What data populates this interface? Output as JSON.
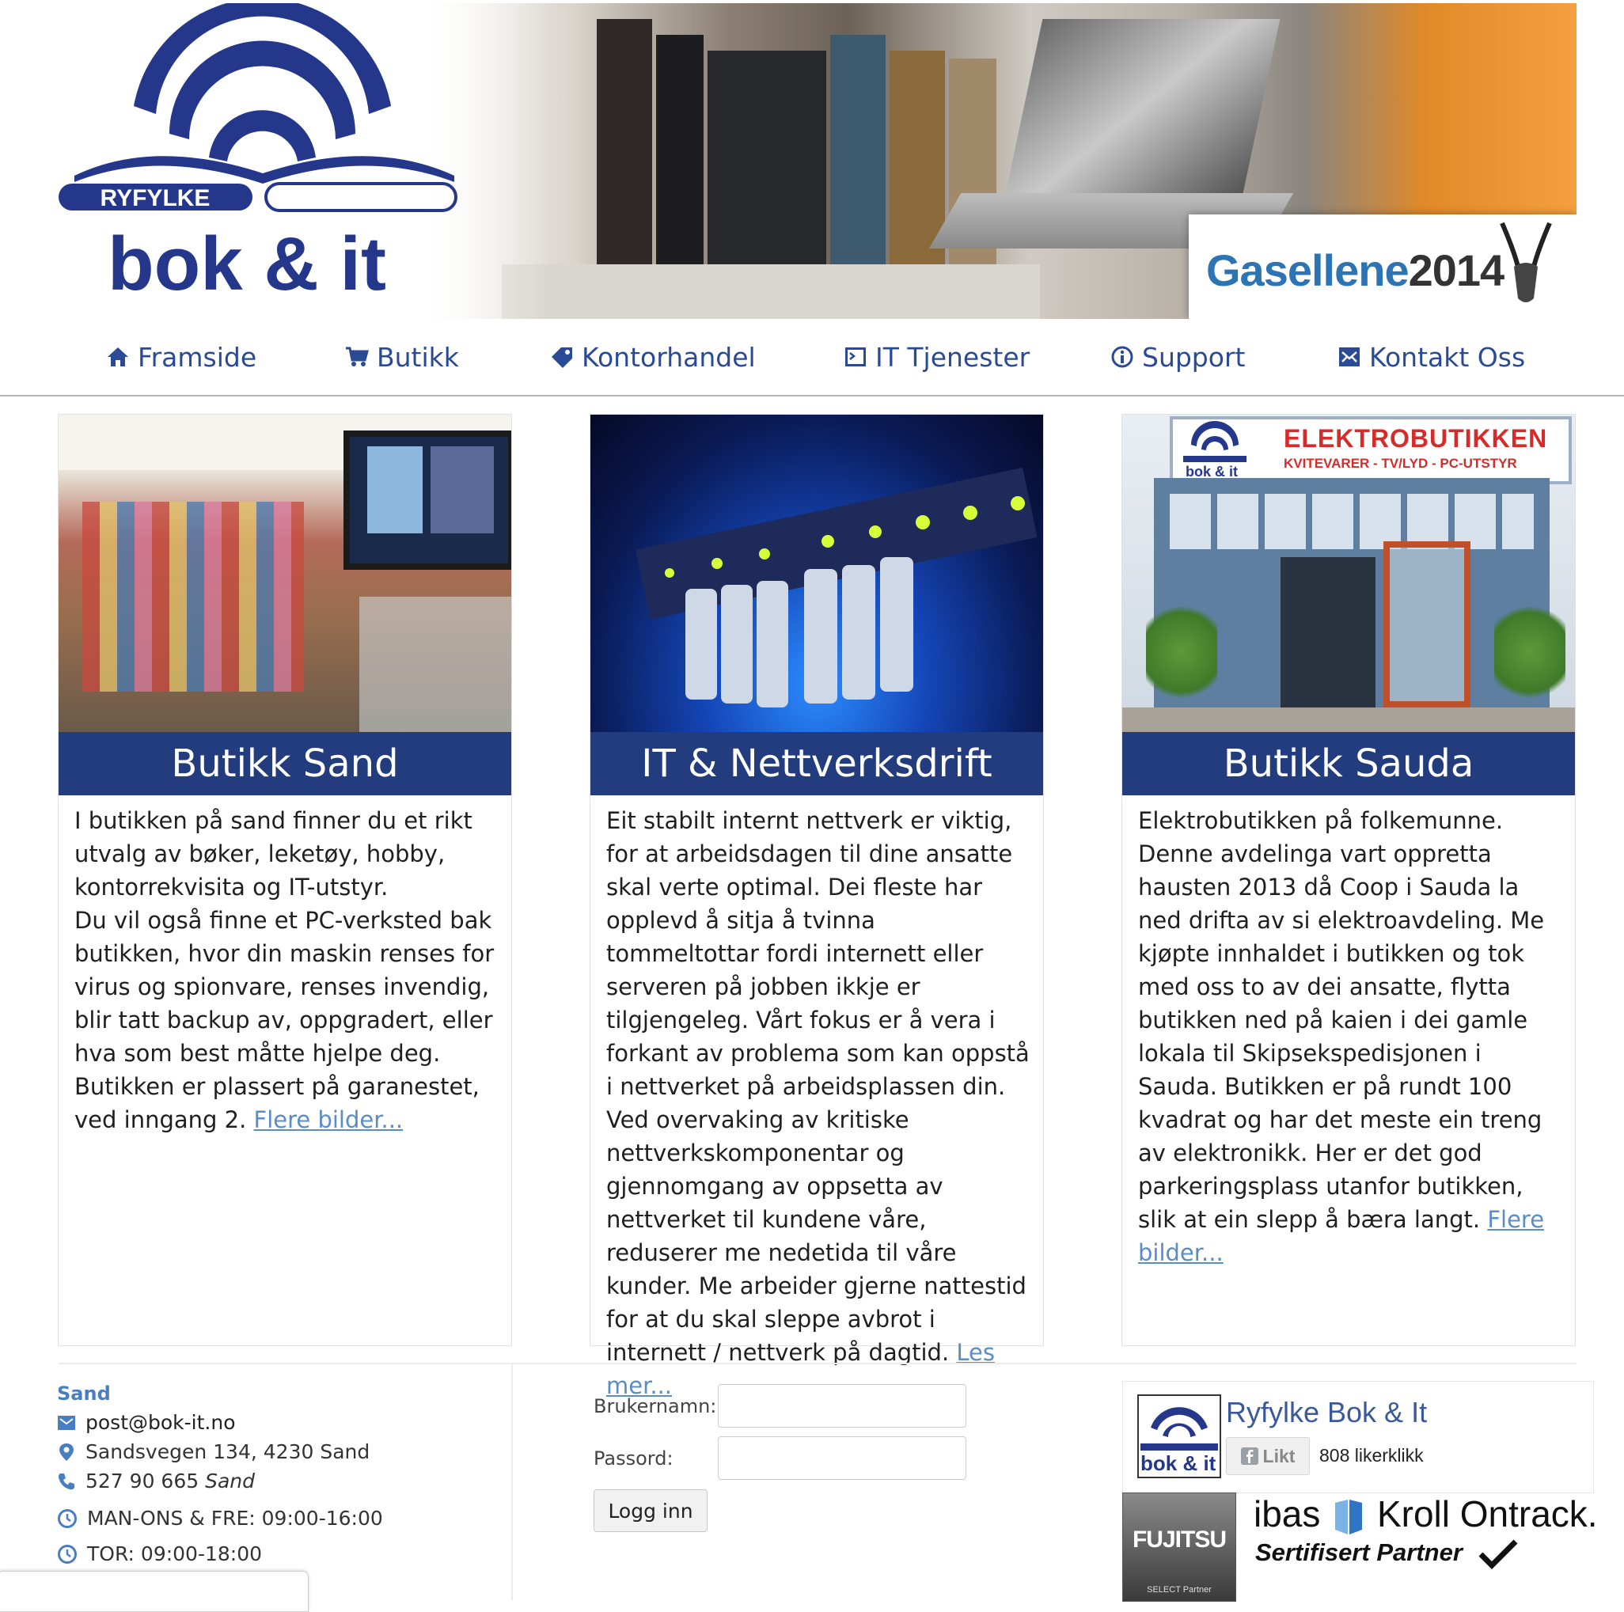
{
  "banner": {
    "logo_top_word": "RYFYLKE",
    "logo_main": "bok & it",
    "award_word": "Gasellene",
    "award_year": "2014"
  },
  "nav": {
    "items": [
      {
        "label": "Framside",
        "icon": "home-icon"
      },
      {
        "label": "Butikk",
        "icon": "cart-icon"
      },
      {
        "label": "Kontorhandel",
        "icon": "tag-icon"
      },
      {
        "label": "IT Tjenester",
        "icon": "terminal-icon"
      },
      {
        "label": "Support",
        "icon": "info-icon"
      },
      {
        "label": "Kontakt Oss",
        "icon": "envelope-icon"
      }
    ]
  },
  "cards": [
    {
      "title": "Butikk Sand",
      "text": "I butikken på sand finner du et rikt utvalg av bøker, leketøy, hobby, kontorrekvisita og IT-utstyr.\nDu vil også finne et PC-verksted bak butikken, hvor din maskin renses for virus og spionvare, renses invendig, blir tatt backup av, oppgradert, eller hva som best måtte hjelpe deg.\nButikken er plassert på garanestet, ved inngang 2. ",
      "link": "Flere bilder..."
    },
    {
      "title": "IT & Nettverksdrift",
      "text": "Eit stabilt internt nettverk er viktig, for at arbeidsdagen til dine ansatte skal verte optimal. Dei fleste har opplevd å sitja å tvinna tommeltottar fordi internett eller serveren på jobben ikkje er tilgjengeleg. Vårt fokus er å vera i forkant av problema som kan oppstå i nettverket på arbeidsplassen din. Ved overvaking av kritiske nettverkskomponentar og gjennomgang av oppsetta av nettverket til kundene våre, reduserer me nedetida til våre kunder. Me arbeider gjerne nattestid for at du skal sleppe avbrot i internett / nettverk på dagtid. ",
      "link": "Les mer..."
    },
    {
      "title": "Butikk Sauda",
      "text": "Elektrobutikken på folkemunne. Denne avdelinga vart oppretta hausten 2013 då Coop i Sauda la ned drifta av si elektroavdeling. Me kjøpte innhaldet i butikken og tok med oss to av dei ansatte, flytta butikken ned på kaien i dei gamle lokala til Skipsekspedisjonen i Sauda. Butikken er på rundt 100 kvadrat og har det meste ein treng av elektronikk. Her er det god parkeringsplass utanfor butikken, slik at ein slepp å bæra langt. ",
      "link": "Flere bilder...",
      "sign_title": "ELEKTROBUTIKKEN",
      "sign_sub": "KVITEVARER - TV/LYD - PC-UTSTYR"
    }
  ],
  "contact": {
    "location": "Sand",
    "email": "post@bok-it.no",
    "address": "Sandsvegen 134, 4230 Sand",
    "phone": "527 90 665",
    "phone_loc": "Sand",
    "hours1": "MAN-ONS & FRE: 09:00-16:00",
    "hours2": "TOR: 09:00-18:00"
  },
  "login": {
    "username_label": "Brukernamn:",
    "password_label": "Passord:",
    "username_value": "",
    "password_value": "",
    "button": "Logg inn"
  },
  "facebook": {
    "page_name": "Ryfylke Bok & It",
    "like_label": "Likt",
    "like_count": "808 likerklikk"
  },
  "partners": {
    "fujitsu": "FUJITSU",
    "fujitsu_sub": "SELECT Partner",
    "ibas": "ibas",
    "kroll": "Kroll Ontrack.",
    "certified": "Sertifisert Partner"
  }
}
